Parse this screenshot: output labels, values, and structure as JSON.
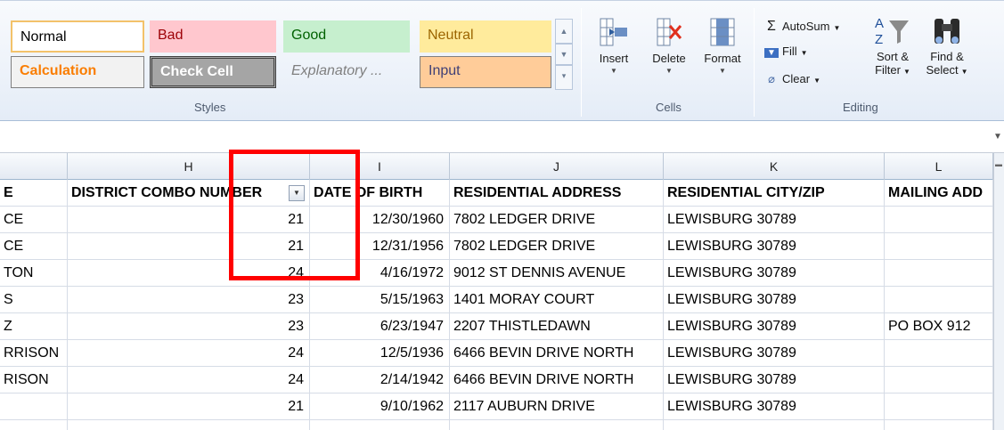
{
  "ribbon": {
    "styles": {
      "label": "Styles",
      "normal": "Normal",
      "bad": "Bad",
      "good": "Good",
      "neutral": "Neutral",
      "calculation": "Calculation",
      "check_cell": "Check Cell",
      "explanatory": "Explanatory ...",
      "input": "Input"
    },
    "cells": {
      "label": "Cells",
      "insert": "Insert",
      "delete": "Delete",
      "format": "Format"
    },
    "editing": {
      "label": "Editing",
      "autosum": "AutoSum",
      "fill": "Fill",
      "clear": "Clear",
      "sort_filter_line1": "Sort &",
      "sort_filter_line2": "Filter",
      "find_select_line1": "Find &",
      "find_select_line2": "Select"
    }
  },
  "sheet": {
    "columns": [
      {
        "key": "G",
        "label": ""
      },
      {
        "key": "H",
        "label": "H"
      },
      {
        "key": "I",
        "label": "I"
      },
      {
        "key": "J",
        "label": "J"
      },
      {
        "key": "K",
        "label": "K"
      },
      {
        "key": "L",
        "label": "L"
      }
    ],
    "headers": {
      "g": "E",
      "h": "DISTRICT COMBO NUMBER",
      "i": "DATE OF BIRTH",
      "j": "RESIDENTIAL ADDRESS",
      "k": "RESIDENTIAL CITY/ZIP",
      "l": "MAILING ADD"
    },
    "rows": [
      {
        "g": "CE",
        "h": "21",
        "i": "12/30/1960",
        "j": "7802 LEDGER DRIVE",
        "k": "LEWISBURG  30789",
        "l": ""
      },
      {
        "g": "CE",
        "h": "21",
        "i": "12/31/1956",
        "j": "7802 LEDGER DRIVE",
        "k": "LEWISBURG  30789",
        "l": ""
      },
      {
        "g": "TON",
        "h": "24",
        "i": "4/16/1972",
        "j": "9012 ST DENNIS AVENUE",
        "k": "LEWISBURG  30789",
        "l": ""
      },
      {
        "g": "S",
        "h": "23",
        "i": "5/15/1963",
        "j": "1401 MORAY COURT",
        "k": "LEWISBURG  30789",
        "l": ""
      },
      {
        "g": "Z",
        "h": "23",
        "i": "6/23/1947",
        "j": "2207 THISTLEDAWN",
        "k": "LEWISBURG  30789",
        "l": "PO BOX 912"
      },
      {
        "g": "RRISON",
        "h": "24",
        "i": "12/5/1936",
        "j": "6466 BEVIN DRIVE NORTH",
        "k": "LEWISBURG  30789",
        "l": ""
      },
      {
        "g": "RISON",
        "h": "24",
        "i": "2/14/1942",
        "j": "6466 BEVIN DRIVE NORTH",
        "k": "LEWISBURG  30789",
        "l": ""
      },
      {
        "g": "",
        "h": "21",
        "i": "9/10/1962",
        "j": "2117 AUBURN DRIVE",
        "k": "LEWISBURG  30789",
        "l": ""
      },
      {
        "g": "",
        "h": "",
        "i": "",
        "j": "",
        "k": "",
        "l": ""
      }
    ]
  },
  "annotation": {
    "color": "#ff0000"
  }
}
